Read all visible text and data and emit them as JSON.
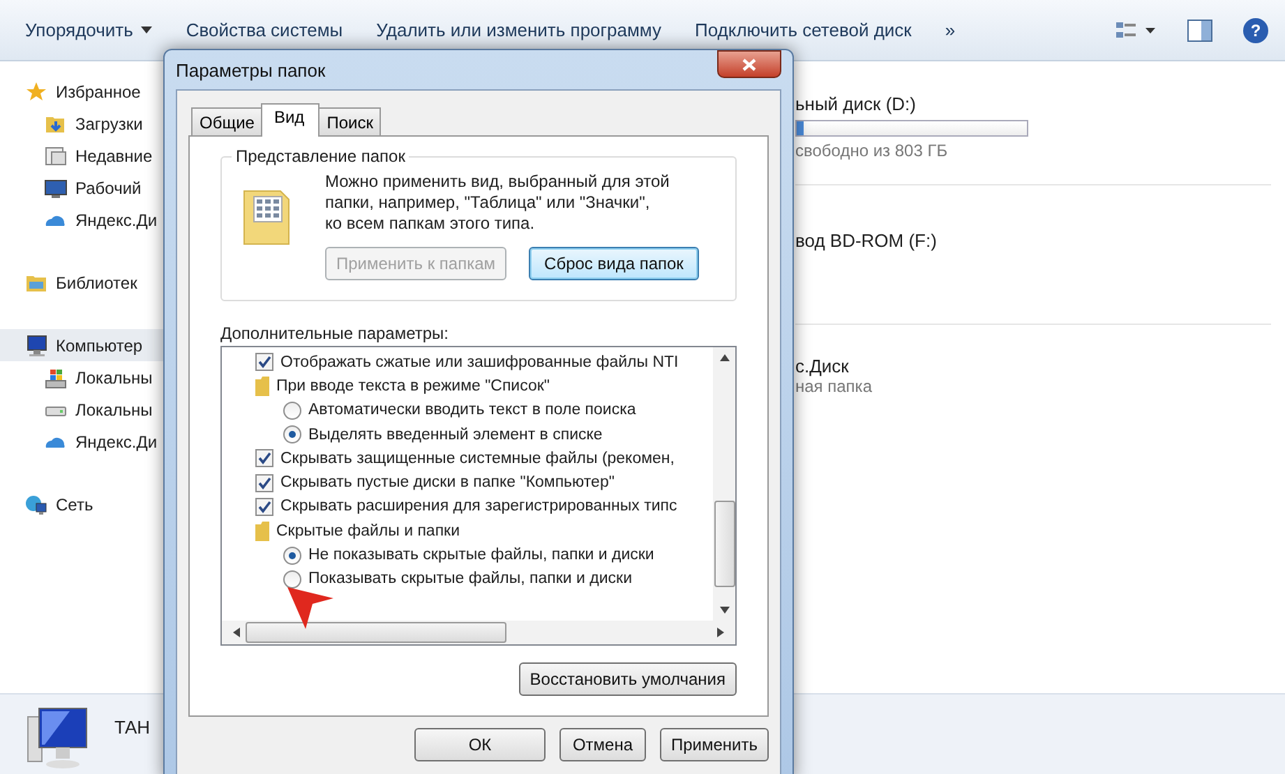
{
  "toolbar": {
    "items": [
      {
        "label": "Упорядочить",
        "has_menu": true
      },
      {
        "label": "Свойства системы",
        "has_menu": false
      },
      {
        "label": "Удалить или изменить программу",
        "has_menu": false
      },
      {
        "label": "Подключить сетевой диск",
        "has_menu": false
      }
    ],
    "overflow": "»",
    "help": "?"
  },
  "sidebar": {
    "groups": [
      {
        "label": "Избранное",
        "kind": "star",
        "selected": false,
        "children": [
          {
            "label": "Загрузки",
            "kind": "download"
          },
          {
            "label": "Недавние",
            "kind": "recent"
          },
          {
            "label": "Рабочий",
            "kind": "desktop"
          },
          {
            "label": "Яндекс.Ди",
            "kind": "cloud"
          }
        ]
      },
      {
        "label": "Библиотек",
        "kind": "library",
        "selected": false
      },
      {
        "label": "Компьютер",
        "kind": "computer",
        "selected": true,
        "children": [
          {
            "label": "Локальны",
            "kind": "system-drive"
          },
          {
            "label": "Локальны",
            "kind": "drive"
          },
          {
            "label": "Яндекс.Ди",
            "kind": "cloud"
          }
        ]
      },
      {
        "label": "Сеть",
        "kind": "network",
        "selected": false
      }
    ]
  },
  "content": {
    "drives": [
      {
        "name": "ьный диск (D:)",
        "level": 0.03,
        "free": "свободно из 803 ГБ"
      },
      {
        "name": "вод BD-ROM (F:)"
      },
      {
        "name": "с.Диск",
        "free": "ная папка"
      }
    ]
  },
  "details": {
    "name": "ТАН"
  },
  "dialog": {
    "title": "Параметры папок",
    "tabs": [
      {
        "label": "Общие",
        "selected": false
      },
      {
        "label": "Вид",
        "selected": true
      },
      {
        "label": "Поиск",
        "selected": false
      }
    ],
    "folder_views": {
      "title": "Представление папок",
      "description": "Можно применить вид, выбранный для этой\nпапки, например, \"Таблица\" или \"Значки\",\nко всем папкам этого типа.",
      "buttons": [
        {
          "label": "Применить к папкам",
          "disabled": true,
          "focused": false
        },
        {
          "label": "Сброс вида папок",
          "disabled": false,
          "focused": true
        }
      ]
    },
    "advanced_label": "Дополнительные параметры:",
    "options": [
      {
        "kind": "checkbox",
        "label": "Отображать сжатые или зашифрованные файлы NTI",
        "checked": true
      },
      {
        "kind": "folder",
        "label": "При вводе текста в режиме \"Список\""
      },
      {
        "kind": "radio",
        "label": "Автоматически вводить текст в поле поиска",
        "checked": false
      },
      {
        "kind": "radio",
        "label": "Выделять введенный элемент в списке",
        "checked": true
      },
      {
        "kind": "checkbox",
        "label": "Скрывать защищенные системные файлы (рекомен,",
        "checked": true
      },
      {
        "kind": "checkbox",
        "label": "Скрывать пустые диски в папке \"Компьютер\"",
        "checked": true
      },
      {
        "kind": "checkbox",
        "label": "Скрывать расширения для зарегистрированных типс",
        "checked": true
      },
      {
        "kind": "folder",
        "label": "Скрытые файлы и папки"
      },
      {
        "kind": "radio",
        "label": "Не показывать скрытые файлы, папки и диски",
        "checked": true
      },
      {
        "kind": "radio",
        "label": "Показывать скрытые файлы, папки и диски",
        "checked": false
      }
    ],
    "restore_button": "Восстановить умолчания",
    "footer_buttons": [
      "ОК",
      "Отмена",
      "Применить"
    ]
  }
}
